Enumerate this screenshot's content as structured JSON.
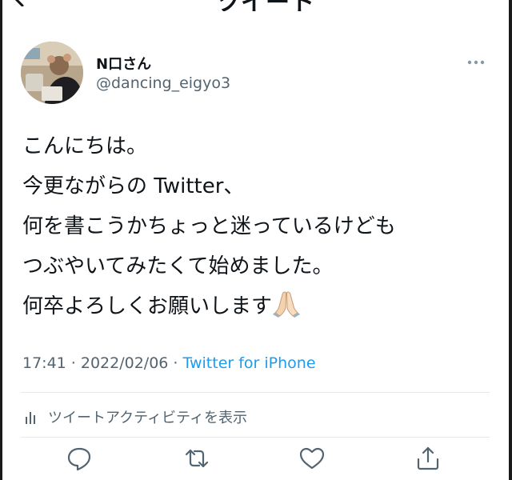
{
  "header": {
    "title": "ツイート",
    "back_icon": "chevron-left-icon"
  },
  "tweet": {
    "author": {
      "display_name": "N口さん",
      "handle": "@dancing_eigyo3",
      "avatar_icon": "avatar-photo"
    },
    "more_icon": "more-horizontal-icon",
    "lines": [
      "こんにちは。",
      "今更ながらの Twitter、",
      "何を書こうかちょっと迷っているけども",
      "つぶやいてみたくて始めました。",
      "何卒よろしくお願いします"
    ],
    "emoji": "🙏",
    "timestamp": "17:41 · 2022/02/06 · ",
    "source": "Twitter for iPhone"
  },
  "activity": {
    "label": "ツイートアクティビティを表示",
    "icon": "bar-chart-icon"
  },
  "actions": {
    "icons": [
      "reply-icon",
      "retweet-icon",
      "like-icon",
      "share-icon"
    ]
  },
  "colors": {
    "text": "#0f1419",
    "secondary": "#536471",
    "link": "#1d9bf0",
    "divider": "#e6e8ea"
  }
}
